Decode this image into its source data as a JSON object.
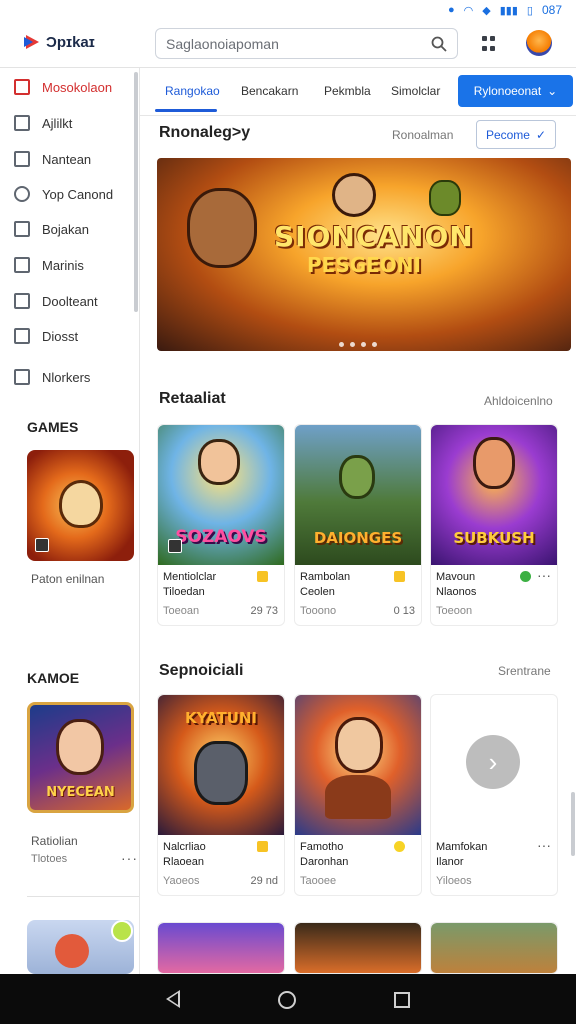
{
  "status": {
    "time": "087"
  },
  "appbar": {
    "logo": "Ɔpɪkaɪ",
    "search_placeholder": "Saglaonoiapoman"
  },
  "sidebar": {
    "items": [
      {
        "label": "Mosokolaon",
        "icon": "store-icon",
        "active": true
      },
      {
        "label": "Ajlilkt",
        "icon": "apps-icon",
        "active": false
      },
      {
        "label": "Nantean",
        "icon": "grid-icon",
        "active": false
      },
      {
        "label": "Yop Canond",
        "icon": "compass-icon",
        "active": false
      },
      {
        "label": "Bojakan",
        "icon": "document-icon",
        "active": false
      },
      {
        "label": "Marinis",
        "icon": "chart-icon",
        "active": false
      },
      {
        "label": "Doolteant",
        "icon": "book-icon",
        "active": false
      },
      {
        "label": "Diosst",
        "icon": "home-icon",
        "active": false
      },
      {
        "label": "Nlorkers",
        "icon": "news-icon",
        "active": false
      }
    ],
    "games_heading": "GAMES",
    "games_card_caption": "Paton enilnan",
    "kamoe_heading": "KAMOE",
    "kamoe_card_caption": "Ratiolian",
    "kamoe_card_sub": "Tlotoes",
    "kamoe_card_art": "NYECEAN"
  },
  "tabs": {
    "items": [
      "Rangokao",
      "Bencakarn",
      "Pekmbla",
      "Simolclar"
    ],
    "dropdown": "Rylonoeonat"
  },
  "featured": {
    "title": "Rnonaleg>y",
    "link": "Ronoalman",
    "button": "Pecome",
    "banner_title": "SIONCANON",
    "banner_sub": "PESGEONI"
  },
  "section1": {
    "title": "Retaaliat",
    "link": "Ahldoicenlno",
    "cards": [
      {
        "name": "Mentiolclar",
        "sub": "Tiloedan",
        "meta": "Toeoan",
        "size": "29 73",
        "art": "SOZAOVS",
        "art_color": "#ff4fa0"
      },
      {
        "name": "Rambolan",
        "sub": "Ceolen",
        "meta": "Tooono",
        "size": "0 13",
        "art": "DAIONGES",
        "art_color": "#ffb02e"
      },
      {
        "name": "Mavoun",
        "sub": "Nlaonos",
        "meta": "Toeoon",
        "size": "",
        "art": "SUBKUSH",
        "art_color": "#ffcd3c"
      }
    ]
  },
  "section2": {
    "title": "Sepnoiciali",
    "link": "Srentrane",
    "cards": [
      {
        "name": "Nalcrliao",
        "sub": "Rlaoean",
        "meta": "Yaoeos",
        "size": "29 nd",
        "art": "KYATUNI",
        "art_color": "#ffb02e"
      },
      {
        "name": "Famotho",
        "sub": "Daronhan",
        "meta": "Taooee",
        "size": "",
        "art": "",
        "art_color": "#ffffff"
      },
      {
        "name": "Mamfokan",
        "sub": "Ilanor",
        "meta": "Yiloeos",
        "size": "",
        "art": "",
        "art_color": "#ffffff"
      }
    ]
  }
}
